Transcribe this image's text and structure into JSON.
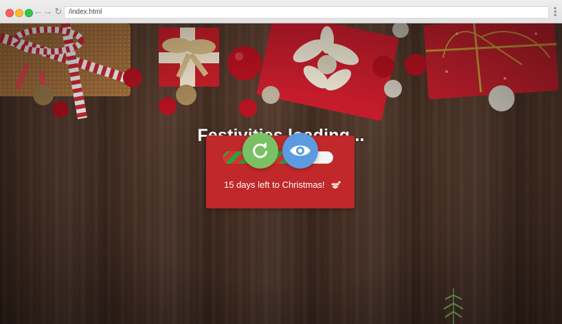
{
  "browser": {
    "address": "/index.html"
  },
  "page": {
    "title": "Festivities loading...",
    "progress_percent": 60,
    "countdown_text": "15 days left to Christmas!",
    "emoji": "santa-emoji"
  },
  "icons": {
    "reload": "reload-icon",
    "refresh_button": "refresh-icon",
    "view_button": "eye-icon"
  },
  "colors": {
    "card": "#c0282a",
    "refresh_button": "#79c164",
    "view_button": "#5b9bdf",
    "stripe_green": "#2f9f3c",
    "stripe_red": "#d7322f"
  }
}
